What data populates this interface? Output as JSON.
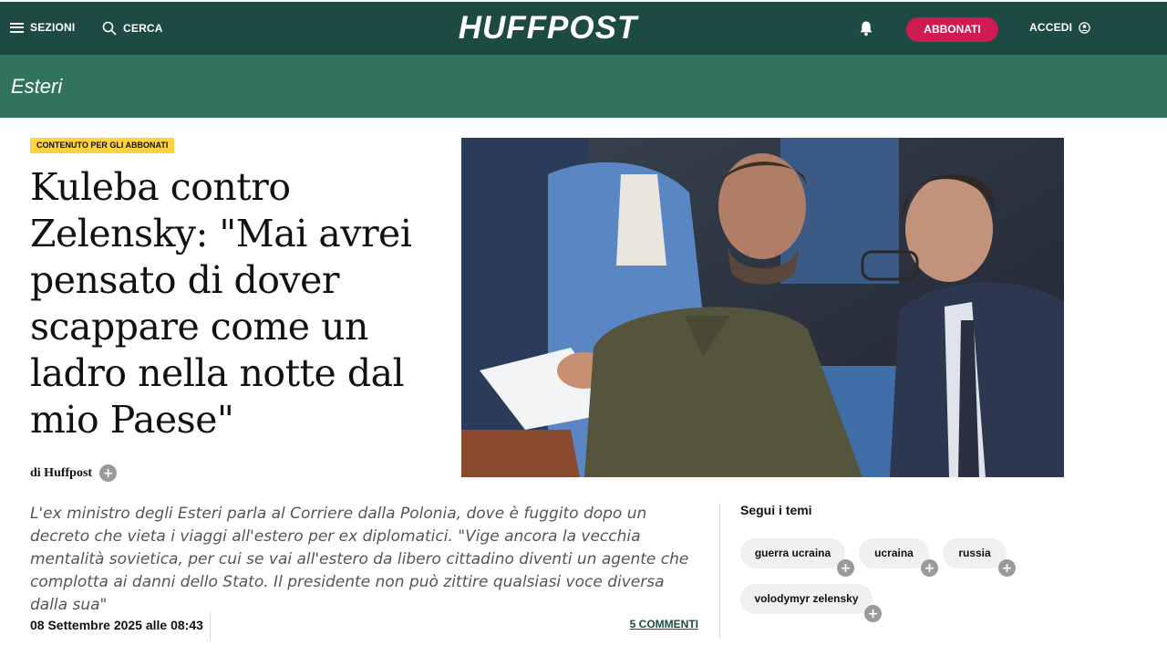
{
  "nav": {
    "sections_label": "SEZIONI",
    "search_label": "CERCA",
    "logo": "HUFFPOST",
    "subscribe_label": "ABBONATI",
    "login_label": "ACCEDI",
    "icons": [
      "menu-icon",
      "search-icon",
      "bell-icon",
      "user-icon"
    ]
  },
  "section": {
    "name": "Esteri"
  },
  "article": {
    "badge": "CONTENUTO PER GLI ABBONATI",
    "headline": "Kuleba contro Zelensky: \"Mai avrei pensato di dover scappare come un ladro nella notte dal mio Paese\"",
    "byline": "di Huffpost",
    "lead": "L'ex ministro degli Esteri parla al Corriere dalla Polonia, dove è fuggito dopo un decreto che vieta i viaggi all'estero per ex diplomatici.  \"Vige ancora la vecchia mentalità sovietica, per cui se vai all'estero da libero cittadino diventi un agente che complotta ai danni dello Stato. Il presidente non può zittire qualsiasi voce diversa dalla sua\"",
    "date": "08 Settembre 2025 alle 08:43",
    "comments": "5 COMMENTI"
  },
  "topics": {
    "title": "Segui i temi",
    "tags": [
      "guerra ucraina",
      "ucraina",
      "russia",
      "volodymyr zelensky"
    ]
  },
  "colors": {
    "topbar": "#1e4a44",
    "section_band": "#31735f",
    "subscribe": "#cf1a52",
    "badge": "#ffd23f"
  }
}
